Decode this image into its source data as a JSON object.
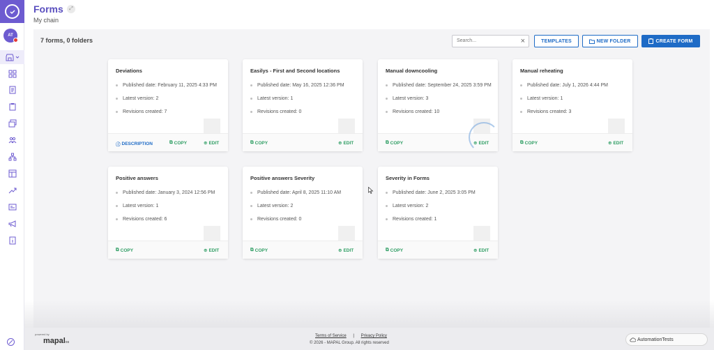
{
  "header": {
    "title": "Forms",
    "subtitle": "My chain"
  },
  "toolbar": {
    "count": "7 forms, 0 folders",
    "search_placeholder": "Search...",
    "templates_label": "TEMPLATES",
    "new_folder_label": "NEW FOLDER",
    "create_form_label": "CREATE FORM"
  },
  "user": {
    "initials": "AT"
  },
  "cards": [
    {
      "title": "Deviations",
      "published": "Published date: February 11, 2025 4:33 PM",
      "version": "Latest version: 2",
      "revisions": "Revisions created: 7",
      "description": "DESCRIPTION",
      "copy": "COPY",
      "edit": "EDIT"
    },
    {
      "title": "Easilys - First and Second locations",
      "published": "Published date: May 16, 2025 12:36 PM",
      "version": "Latest version: 1",
      "revisions": "Revisions created: 0",
      "copy": "COPY",
      "edit": "EDIT"
    },
    {
      "title": "Manual downcooling",
      "published": "Published date: September 24, 2025 3:59 PM",
      "version": "Latest version: 3",
      "revisions": "Revisions created: 10",
      "copy": "COPY",
      "edit": "EDIT"
    },
    {
      "title": "Manual reheating",
      "published": "Published date: July 1, 2026 4:44 PM",
      "version": "Latest version: 1",
      "revisions": "Revisions created: 3",
      "copy": "COPY",
      "edit": "EDIT"
    },
    {
      "title": "Positive answers",
      "published": "Published date: January 3, 2024 12:56 PM",
      "version": "Latest version: 1",
      "revisions": "Revisions created: 6",
      "copy": "COPY",
      "edit": "EDIT"
    },
    {
      "title": "Positive answers Severity",
      "published": "Published date: April 8, 2025 11:10 AM",
      "version": "Latest version: 2",
      "revisions": "Revisions created: 0",
      "copy": "COPY",
      "edit": "EDIT"
    },
    {
      "title": "Severity in Forms",
      "published": "Published date: June 2, 2025 3:05 PM",
      "version": "Latest version: 2",
      "revisions": "Revisions created: 1",
      "copy": "COPY",
      "edit": "EDIT"
    }
  ],
  "footer": {
    "powered": "powered by",
    "brand": "mapal",
    "brand_suffix": "os",
    "terms": "Terms of Service",
    "separator": "|",
    "privacy": "Privacy Policy",
    "copyright": "© 2026 - MAPAL Group. All rights reserved",
    "account": "AutomationTests"
  },
  "colors": {
    "accent": "#6d5bd0",
    "primary": "#1e6bc6",
    "action_green": "#2e9d63"
  }
}
